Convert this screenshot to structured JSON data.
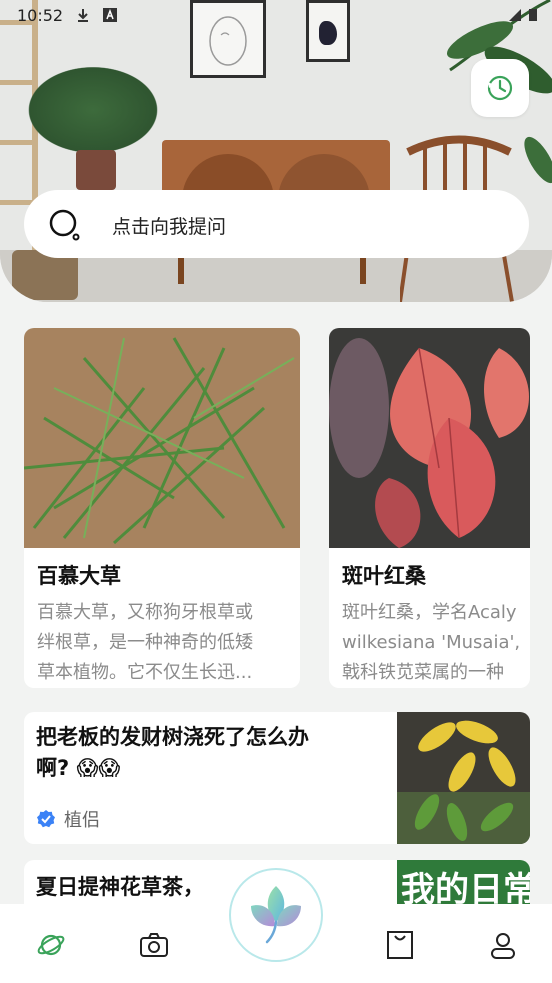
{
  "status_bar": {
    "time": "10:52"
  },
  "search": {
    "placeholder": "点击向我提问"
  },
  "cards": [
    {
      "title": "百慕大草",
      "desc_lines": [
        "百慕大草，又称狗牙根草或",
        "绊根草，是一种神奇的低矮",
        "草本植物。它不仅生长迅..."
      ]
    },
    {
      "title": "斑叶红桑",
      "desc_lines": [
        "斑叶红桑，学名Acaly",
        "wilkesiana 'Musaia',",
        "戟科铁苋菜属的一种"
      ]
    }
  ],
  "articles": [
    {
      "title_lines": [
        "把老板的发财树浇死了怎么办",
        "啊? 😱😱"
      ],
      "author": "植侣"
    },
    {
      "title_lines": [
        "夏日提神花草茶，",
        "..."
      ]
    }
  ],
  "article2_thumb_text": "我的日常",
  "nav": [
    {
      "icon": "planet-icon"
    },
    {
      "icon": "camera-icon"
    },
    {
      "icon": "leaf-icon"
    },
    {
      "icon": "shopping-bag-icon"
    },
    {
      "icon": "profile-icon"
    }
  ],
  "colors": {
    "accent_green": "#3aa35a",
    "verified_blue": "#3b82f6",
    "background": "#f2f3f2"
  }
}
